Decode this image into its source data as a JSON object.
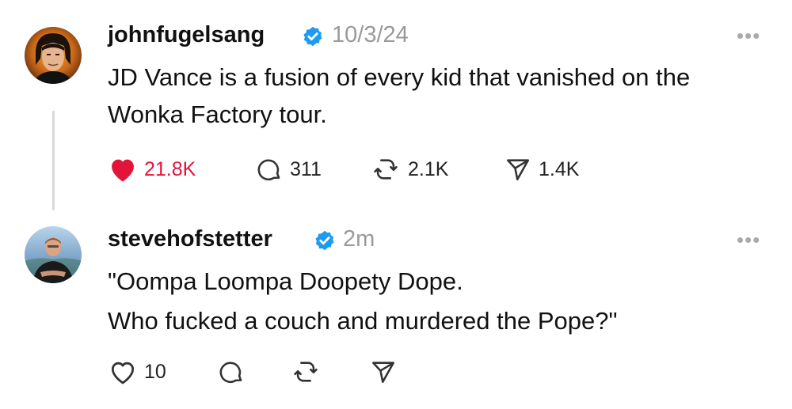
{
  "posts": [
    {
      "username": "johnfugelsang",
      "timestamp": "10/3/24",
      "more_icon": "ellipsis-icon",
      "text_lines": [
        "JD Vance is a fusion of every kid that vanished on the",
        "Wonka Factory tour."
      ],
      "liked": true,
      "accent_color": "#e3143a",
      "actions": {
        "likes": "21.8K",
        "replies": "311",
        "reposts": "2.1K",
        "shares": "1.4K"
      }
    },
    {
      "username": "stevehofstetter",
      "timestamp": "2m",
      "more_icon": "ellipsis-icon",
      "text_lines": [
        "\"Oompa Loompa Doopety Dope.",
        "Who fucked a couch and murdered the Pope?\""
      ],
      "liked": false,
      "actions": {
        "likes": "10",
        "replies": "",
        "reposts": "",
        "shares": ""
      }
    }
  ],
  "verified_color": "#1d9bf0"
}
